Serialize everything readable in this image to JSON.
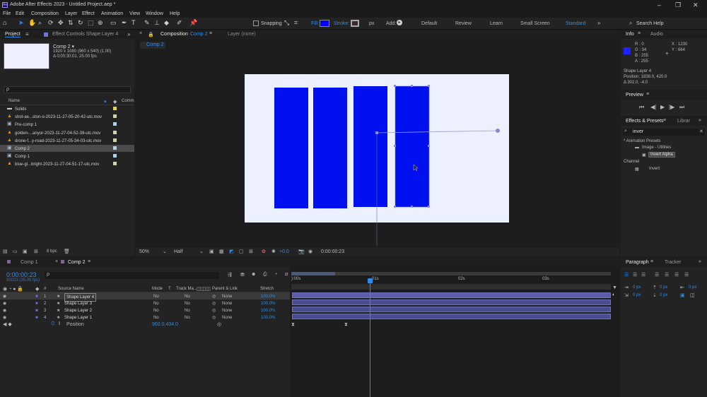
{
  "app": {
    "title": "Adobe After Effects 2023 - Untitled Project.aep *",
    "icon_name": "ae-logo-icon",
    "window_controls": [
      "minimize-icon",
      "maximize-icon",
      "close-icon"
    ]
  },
  "menu": [
    "File",
    "Edit",
    "Composition",
    "Layer",
    "Effect",
    "Animation",
    "View",
    "Window",
    "Help"
  ],
  "toolbar": {
    "snapping_label": "Snapping",
    "fill_label": "Fill:",
    "stroke_label": "Stroke:",
    "stroke_unit": "px",
    "add_label": "Add:",
    "workspaces": [
      "Default",
      "Review",
      "Learn",
      "Small Screen",
      "Standard"
    ],
    "active_workspace": "Standard",
    "search_help_placeholder": "Search Help",
    "fill_color": "#0000ff"
  },
  "project_panel": {
    "tab_label": "Project",
    "effect_controls_label": "Effect Controls Shape Layer 4",
    "comp_name": "Comp 2 ▾",
    "comp_info_1": "1920 x 1080 (960 x 540) (1.00)",
    "comp_info_2": "Δ 0;00;30;01, 25.00 fps",
    "search_placeholder": "ρ",
    "col_name": "Name",
    "col_comment": "Comm",
    "items": [
      {
        "name": "Solids",
        "icon": "folder-icon",
        "swatch": "#e8d14a"
      },
      {
        "name": "shot-ae...ston-o-2023-11-27-05-20-42-utc.mov",
        "icon": "vlc-cone-icon",
        "swatch": "#d2d2b0"
      },
      {
        "name": "Pre-comp 1",
        "icon": "comp-icon",
        "swatch": "#b4d2e6"
      },
      {
        "name": "golden-...anyor-2023-11-27-04-52-39-utc.mov",
        "icon": "vlc-cone-icon",
        "swatch": "#d2d2b0"
      },
      {
        "name": "drone-f...y-road-2023-11-27-05-34-03-utc.mov",
        "icon": "vlc-cone-icon",
        "swatch": "#d2d2b0"
      },
      {
        "name": "Comp 2",
        "icon": "comp-icon",
        "swatch": "#b4d2e6"
      },
      {
        "name": "Comp 1",
        "icon": "comp-icon",
        "swatch": "#b4d2e6"
      },
      {
        "name": "blue-gl...bright-2023-11-27-04-51-17-utc.mov",
        "icon": "vlc-cone-icon",
        "swatch": "#d2d2b0"
      }
    ],
    "bpc_label": "8 bpc"
  },
  "composition_panel": {
    "tab_label": "Composition",
    "tab_comp": "Comp 2",
    "layer_tab": "Layer (none)",
    "breadcrumb": "Comp 2",
    "zoom": "50%",
    "resolution": "Half",
    "exposure": "+0.0",
    "timecode": "0:00:00:23",
    "canvas_bg": "#ecf0ff",
    "shape_color": "#0010ee"
  },
  "info_panel": {
    "tab_info": "Info",
    "tab_audio": "Audio",
    "r": "R : 0",
    "g": "G : 34",
    "b": "B : 255",
    "a": "A : 255",
    "x": "X : 1230",
    "y": "Y : 664",
    "layer_name": "Shape Layer 4",
    "position": "Position: 1838.0, 420.0",
    "delta": "Δ 302.0, -4.0",
    "swatch": "#1a22ff"
  },
  "preview_panel": {
    "tab_label": "Preview"
  },
  "effects_panel": {
    "tab_label": "Effects & Presets",
    "tab_library": "Librar",
    "search_value": "inver",
    "tree": [
      {
        "label": "* Animation Presets",
        "indent": 0
      },
      {
        "label": "Image - Utilities",
        "indent": 1
      },
      {
        "label": "Invert Alpha",
        "indent": 2
      },
      {
        "label": "Channel",
        "indent": 0
      },
      {
        "label": "Invert",
        "indent": 2
      }
    ]
  },
  "timeline": {
    "tab_comp1": "Comp 1",
    "tab_comp2": "Comp 2",
    "timecode": "0:00:00:23",
    "timecode_sub": "00023 (25.00 fps)",
    "search_placeholder": "ρ",
    "col_headers": [
      "#",
      "Source Name",
      "Mode",
      "T",
      "Track Ma...",
      "Parent & Link",
      "Stretch"
    ],
    "layers": [
      {
        "num": "1",
        "name": "Shape Layer 4",
        "mode": "No",
        "track": "No",
        "parent": "None",
        "stretch": "100.0%",
        "selected": true
      },
      {
        "num": "2",
        "name": "Shape Layer 3",
        "mode": "No",
        "track": "No",
        "parent": "None",
        "stretch": "100.0%",
        "selected": false
      },
      {
        "num": "3",
        "name": "Shape Layer 2",
        "mode": "No",
        "track": "No",
        "parent": "None",
        "stretch": "100.0%",
        "selected": false
      },
      {
        "num": "4",
        "name": "Shape Layer 1",
        "mode": "No",
        "track": "No",
        "parent": "None",
        "stretch": "100.0%",
        "selected": false
      }
    ],
    "property_name": "Position",
    "property_value": "960.0,434.0",
    "ruler_ticks": [
      "):00s",
      "01s",
      "02s",
      "03s"
    ],
    "layer_bar_color": "#5b5dab"
  },
  "paragraph_panel": {
    "tab_label": "Paragraph",
    "tab_tracker": "Tracker",
    "indent_values": [
      "0 px",
      "0 px",
      "0 px",
      "0 px",
      "0 px"
    ]
  }
}
